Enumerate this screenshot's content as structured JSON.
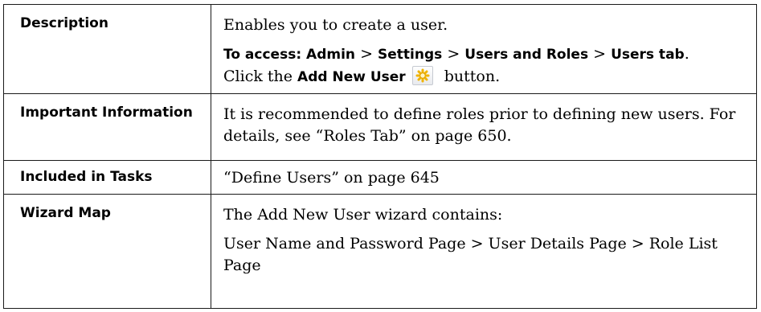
{
  "rows": [
    {
      "label": "Description",
      "body_line1": "Enables you to create a user.",
      "access_prefix": "To access: ",
      "access_admin": "Admin",
      "sep1": " > ",
      "access_settings": "Settings",
      "sep2": " > ",
      "access_users_roles": "Users and Roles",
      "sep3": " > ",
      "access_users_tab": "Users tab",
      "period": ".",
      "click_prefix": "Click the ",
      "add_new_user": "Add New User",
      "button_suffix": " button.",
      "icon": "add-user-icon"
    },
    {
      "label": "Important Information",
      "body": "It is recommended to define roles prior to defining new users. For details, see “Roles Tab” on page 650."
    },
    {
      "label": "Included in Tasks",
      "body": "“Define Users” on page 645"
    },
    {
      "label": "Wizard Map",
      "body_line1": "The Add New User wizard contains:",
      "body_line2": "User Name and Password Page > User Details Page > Role List Page"
    }
  ],
  "colors": {
    "border": "#1a1a1a",
    "icon": "#f0b400"
  }
}
